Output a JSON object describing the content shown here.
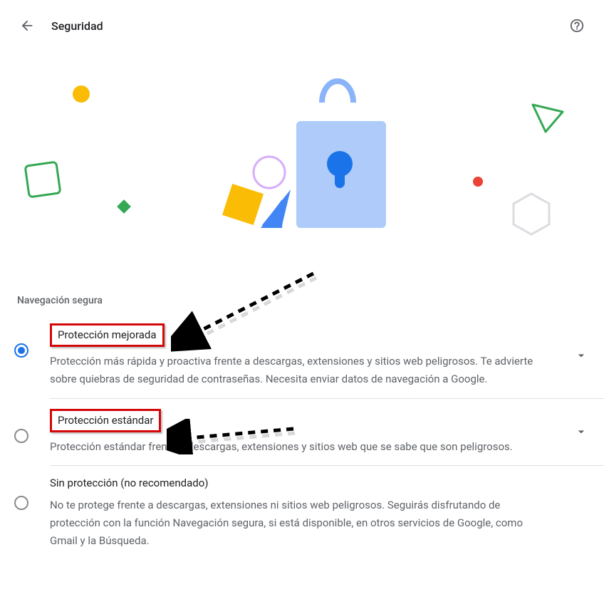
{
  "header": {
    "title": "Seguridad"
  },
  "section": {
    "heading": "Navegación segura"
  },
  "options": {
    "enhanced": {
      "title": "Protección mejorada",
      "description": "Protección más rápida y proactiva frente a descargas, extensiones y sitios web peligrosos. Te advierte sobre quiebras de seguridad de contraseñas. Necesita enviar datos de navegación a Google."
    },
    "standard": {
      "title": "Protección estándar",
      "description": "Protección estándar frente a descargas, extensiones y sitios web que se sabe que son peligrosos."
    },
    "none": {
      "title": "Sin protección (no recomendado)",
      "description": "No te protege frente a descargas, extensiones ni sitios web peligrosos. Seguirás disfrutando de protección con la función Navegación segura, si está disponible, en otros servicios de Google, como Gmail y la Búsqueda."
    }
  }
}
